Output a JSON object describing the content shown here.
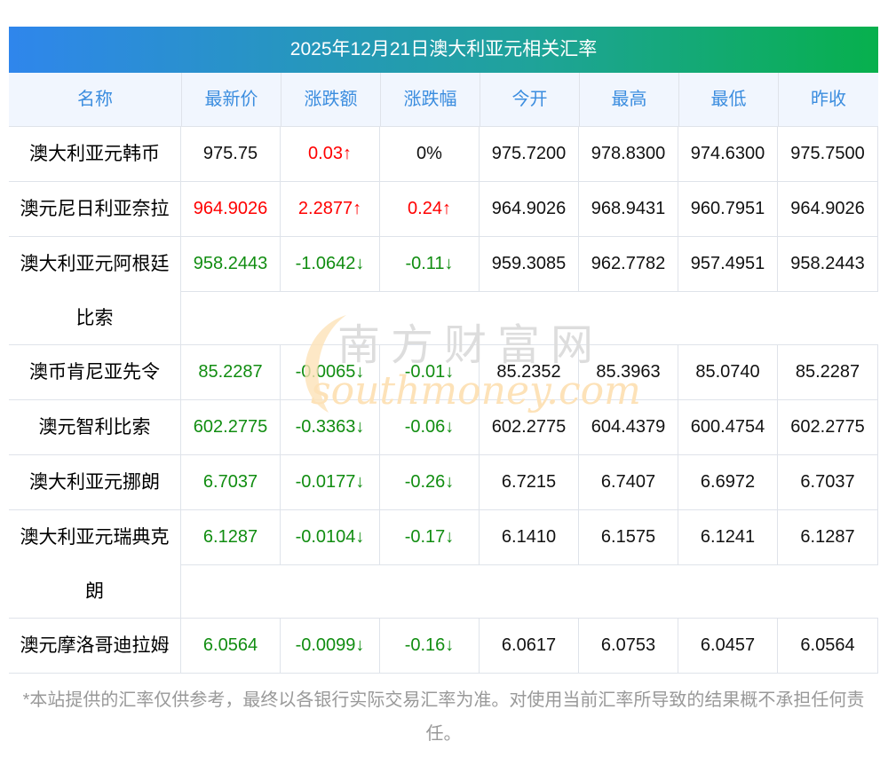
{
  "title": "2025年12月21日澳大利亚元相关汇率",
  "headers": [
    "名称",
    "最新价",
    "涨跌额",
    "涨跌幅",
    "今开",
    "最高",
    "最低",
    "昨收"
  ],
  "rows": [
    {
      "name": "澳大利亚元韩币",
      "values": [
        "975.75",
        "0.03↑",
        "0%",
        "975.7200",
        "978.8300",
        "974.6300",
        "975.7500"
      ],
      "trend": [
        "",
        "up",
        ""
      ]
    },
    {
      "name": "澳元尼日利亚奈拉",
      "values": [
        "964.9026",
        "2.2877↑",
        "0.24↑",
        "964.9026",
        "968.9431",
        "960.7951",
        "964.9026"
      ],
      "trend": [
        "up",
        "up",
        "up"
      ]
    },
    {
      "name": "澳大利亚元阿根廷比索",
      "values": [
        "958.2443",
        "-1.0642↓",
        "-0.11↓",
        "959.3085",
        "962.7782",
        "957.4951",
        "958.2443"
      ],
      "trend": [
        "down",
        "down",
        "down"
      ],
      "wrap": true
    },
    {
      "name": "澳币肯尼亚先令",
      "values": [
        "85.2287",
        "-0.0065↓",
        "-0.01↓",
        "85.2352",
        "85.3963",
        "85.0740",
        "85.2287"
      ],
      "trend": [
        "down",
        "down",
        "down"
      ]
    },
    {
      "name": "澳元智利比索",
      "values": [
        "602.2775",
        "-0.3363↓",
        "-0.06↓",
        "602.2775",
        "604.4379",
        "600.4754",
        "602.2775"
      ],
      "trend": [
        "down",
        "down",
        "down"
      ]
    },
    {
      "name": "澳大利亚元挪朗",
      "values": [
        "6.7037",
        "-0.0177↓",
        "-0.26↓",
        "6.7215",
        "6.7407",
        "6.6972",
        "6.7037"
      ],
      "trend": [
        "down",
        "down",
        "down"
      ]
    },
    {
      "name": "澳大利亚元瑞典克朗",
      "values": [
        "6.1287",
        "-0.0104↓",
        "-0.17↓",
        "6.1410",
        "6.1575",
        "6.1241",
        "6.1287"
      ],
      "trend": [
        "down",
        "down",
        "down"
      ],
      "wrap": true
    },
    {
      "name": "澳元摩洛哥迪拉姆",
      "values": [
        "6.0564",
        "-0.0099↓",
        "-0.16↓",
        "6.0617",
        "6.0753",
        "6.0457",
        "6.0564"
      ],
      "trend": [
        "down",
        "down",
        "down"
      ]
    }
  ],
  "watermark": {
    "cn": "南方财富网",
    "en": "southmoney.com"
  },
  "footer": "*本站提供的汇率仅供参考，最终以各银行实际交易汇率为准。对使用当前汇率所导致的结果概不承担任何责任。"
}
